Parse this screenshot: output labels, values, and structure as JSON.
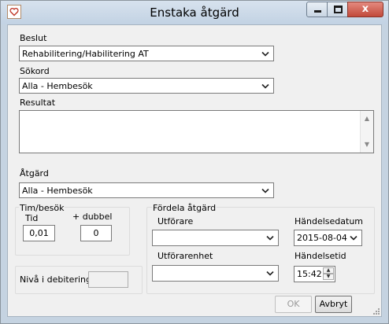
{
  "window": {
    "title": "Enstaka åtgärd",
    "close_label": "x",
    "accent_close": "#c24a3b"
  },
  "form": {
    "beslut_label": "Beslut",
    "beslut_value": "Rehabilitering/Habilitering AT",
    "sokord_label": "Sökord",
    "sokord_value": "Alla - Hembesök",
    "resultat_label": "Resultat",
    "resultat_value": "",
    "atgard_label": "Åtgärd",
    "atgard_value": "Alla - Hembesök"
  },
  "timbesok": {
    "group_label": "Tim/besök",
    "tid_label": "Tid",
    "tid_value": "0,01",
    "dubbel_label": "+ dubbel",
    "dubbel_value": "0"
  },
  "niva": {
    "label": "Nivå i debitering",
    "value": ""
  },
  "fordela": {
    "group_label": "Fördela åtgärd",
    "utforare_label": "Utförare",
    "utforare_value": "",
    "utforarenhet_label": "Utförarenhet",
    "utforarenhet_value": "",
    "handelsedatum_label": "Händelsedatum",
    "handelsedatum_value": "2015-08-04",
    "handelsetid_label": "Händelsetid",
    "handelsetid_value": "15:42"
  },
  "buttons": {
    "ok_label": "OK",
    "cancel_label": "Avbryt"
  }
}
